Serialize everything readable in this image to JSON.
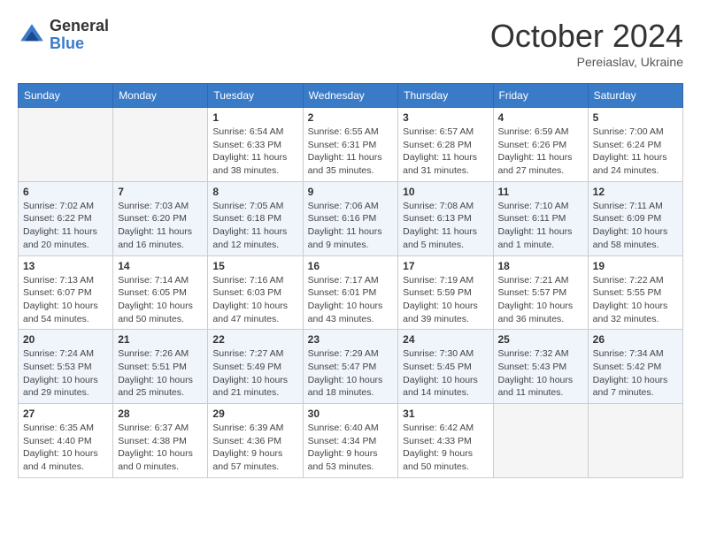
{
  "header": {
    "logo_general": "General",
    "logo_blue": "Blue",
    "month_year": "October 2024",
    "location": "Pereiaslav, Ukraine"
  },
  "days_of_week": [
    "Sunday",
    "Monday",
    "Tuesday",
    "Wednesday",
    "Thursday",
    "Friday",
    "Saturday"
  ],
  "weeks": [
    [
      {
        "day": "",
        "info": ""
      },
      {
        "day": "",
        "info": ""
      },
      {
        "day": "1",
        "info": "Sunrise: 6:54 AM\nSunset: 6:33 PM\nDaylight: 11 hours and 38 minutes."
      },
      {
        "day": "2",
        "info": "Sunrise: 6:55 AM\nSunset: 6:31 PM\nDaylight: 11 hours and 35 minutes."
      },
      {
        "day": "3",
        "info": "Sunrise: 6:57 AM\nSunset: 6:28 PM\nDaylight: 11 hours and 31 minutes."
      },
      {
        "day": "4",
        "info": "Sunrise: 6:59 AM\nSunset: 6:26 PM\nDaylight: 11 hours and 27 minutes."
      },
      {
        "day": "5",
        "info": "Sunrise: 7:00 AM\nSunset: 6:24 PM\nDaylight: 11 hours and 24 minutes."
      }
    ],
    [
      {
        "day": "6",
        "info": "Sunrise: 7:02 AM\nSunset: 6:22 PM\nDaylight: 11 hours and 20 minutes."
      },
      {
        "day": "7",
        "info": "Sunrise: 7:03 AM\nSunset: 6:20 PM\nDaylight: 11 hours and 16 minutes."
      },
      {
        "day": "8",
        "info": "Sunrise: 7:05 AM\nSunset: 6:18 PM\nDaylight: 11 hours and 12 minutes."
      },
      {
        "day": "9",
        "info": "Sunrise: 7:06 AM\nSunset: 6:16 PM\nDaylight: 11 hours and 9 minutes."
      },
      {
        "day": "10",
        "info": "Sunrise: 7:08 AM\nSunset: 6:13 PM\nDaylight: 11 hours and 5 minutes."
      },
      {
        "day": "11",
        "info": "Sunrise: 7:10 AM\nSunset: 6:11 PM\nDaylight: 11 hours and 1 minute."
      },
      {
        "day": "12",
        "info": "Sunrise: 7:11 AM\nSunset: 6:09 PM\nDaylight: 10 hours and 58 minutes."
      }
    ],
    [
      {
        "day": "13",
        "info": "Sunrise: 7:13 AM\nSunset: 6:07 PM\nDaylight: 10 hours and 54 minutes."
      },
      {
        "day": "14",
        "info": "Sunrise: 7:14 AM\nSunset: 6:05 PM\nDaylight: 10 hours and 50 minutes."
      },
      {
        "day": "15",
        "info": "Sunrise: 7:16 AM\nSunset: 6:03 PM\nDaylight: 10 hours and 47 minutes."
      },
      {
        "day": "16",
        "info": "Sunrise: 7:17 AM\nSunset: 6:01 PM\nDaylight: 10 hours and 43 minutes."
      },
      {
        "day": "17",
        "info": "Sunrise: 7:19 AM\nSunset: 5:59 PM\nDaylight: 10 hours and 39 minutes."
      },
      {
        "day": "18",
        "info": "Sunrise: 7:21 AM\nSunset: 5:57 PM\nDaylight: 10 hours and 36 minutes."
      },
      {
        "day": "19",
        "info": "Sunrise: 7:22 AM\nSunset: 5:55 PM\nDaylight: 10 hours and 32 minutes."
      }
    ],
    [
      {
        "day": "20",
        "info": "Sunrise: 7:24 AM\nSunset: 5:53 PM\nDaylight: 10 hours and 29 minutes."
      },
      {
        "day": "21",
        "info": "Sunrise: 7:26 AM\nSunset: 5:51 PM\nDaylight: 10 hours and 25 minutes."
      },
      {
        "day": "22",
        "info": "Sunrise: 7:27 AM\nSunset: 5:49 PM\nDaylight: 10 hours and 21 minutes."
      },
      {
        "day": "23",
        "info": "Sunrise: 7:29 AM\nSunset: 5:47 PM\nDaylight: 10 hours and 18 minutes."
      },
      {
        "day": "24",
        "info": "Sunrise: 7:30 AM\nSunset: 5:45 PM\nDaylight: 10 hours and 14 minutes."
      },
      {
        "day": "25",
        "info": "Sunrise: 7:32 AM\nSunset: 5:43 PM\nDaylight: 10 hours and 11 minutes."
      },
      {
        "day": "26",
        "info": "Sunrise: 7:34 AM\nSunset: 5:42 PM\nDaylight: 10 hours and 7 minutes."
      }
    ],
    [
      {
        "day": "27",
        "info": "Sunrise: 6:35 AM\nSunset: 4:40 PM\nDaylight: 10 hours and 4 minutes."
      },
      {
        "day": "28",
        "info": "Sunrise: 6:37 AM\nSunset: 4:38 PM\nDaylight: 10 hours and 0 minutes."
      },
      {
        "day": "29",
        "info": "Sunrise: 6:39 AM\nSunset: 4:36 PM\nDaylight: 9 hours and 57 minutes."
      },
      {
        "day": "30",
        "info": "Sunrise: 6:40 AM\nSunset: 4:34 PM\nDaylight: 9 hours and 53 minutes."
      },
      {
        "day": "31",
        "info": "Sunrise: 6:42 AM\nSunset: 4:33 PM\nDaylight: 9 hours and 50 minutes."
      },
      {
        "day": "",
        "info": ""
      },
      {
        "day": "",
        "info": ""
      }
    ]
  ]
}
